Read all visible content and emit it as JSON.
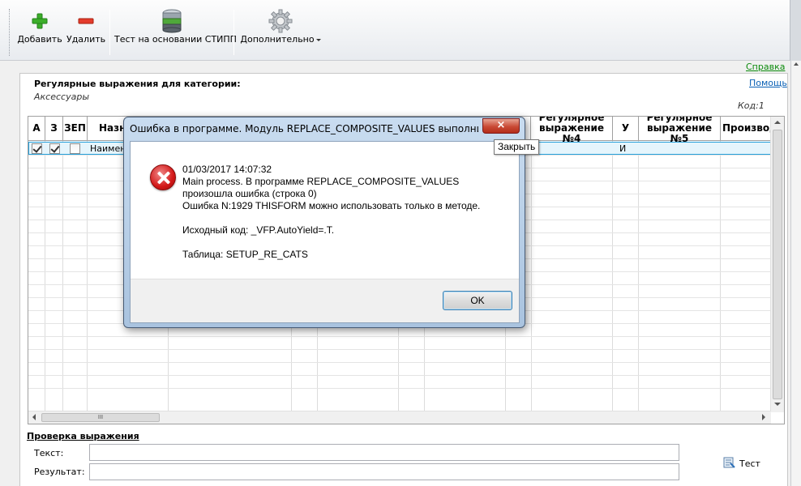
{
  "toolbar": {
    "add": "Добавить",
    "delete": "Удалить",
    "test_stipp": "Тест на основании СТИПП",
    "more": "Дополнительно"
  },
  "links": {
    "help": "Справка",
    "assist": "Помощь"
  },
  "category": {
    "heading": "Регулярные выражения для категории:",
    "name": "Аксессуары",
    "code": "Код:1"
  },
  "grid": {
    "columns": [
      "А",
      "З",
      "ЗЕП",
      "Назн",
      "Регулярное выражение №4",
      "У",
      "Регулярное выражение №5",
      "Производ"
    ],
    "row": {
      "a_checked": true,
      "z_checked": true,
      "zep_checked": false,
      "name": "Наимено",
      "u": "И"
    },
    "hscroll_grip": "III"
  },
  "check": {
    "title": "Проверка выражения",
    "text_label": "Текст:",
    "result_label": "Результат:",
    "text_value": "",
    "result_value": "",
    "test_button": "Тест"
  },
  "dialog": {
    "title": "Ошибка в программе. Модуль REPLACE_COMPOSITE_VALUES выполнил нед...",
    "close_glyph": "×",
    "tooltip": "Закрыть",
    "message": "01/03/2017 14:07:32\nMain process. В программе REPLACE_COMPOSITE_VALUES\nпроизошла ошибка (строка 0)\nОшибка N:1929 THISFORM можно использовать только в методе.\n\nИсходный код: _VFP.AutoYield=.T.\n\nТаблица: SETUP_RE_CATS",
    "ok": "OK"
  }
}
